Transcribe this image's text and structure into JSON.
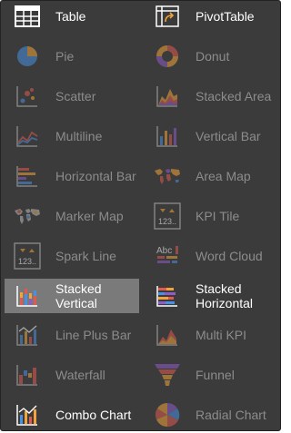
{
  "menu": {
    "items": [
      {
        "key": "table",
        "label": "Table",
        "state": "enabled"
      },
      {
        "key": "pivot",
        "label": "PivotTable",
        "state": "enabled"
      },
      {
        "key": "pie",
        "label": "Pie",
        "state": "disabled"
      },
      {
        "key": "donut",
        "label": "Donut",
        "state": "disabled"
      },
      {
        "key": "scatter",
        "label": "Scatter",
        "state": "disabled"
      },
      {
        "key": "stacked-area",
        "label": "Stacked Area",
        "state": "disabled"
      },
      {
        "key": "multiline",
        "label": "Multiline",
        "state": "disabled"
      },
      {
        "key": "vertical-bar",
        "label": "Vertical Bar",
        "state": "disabled"
      },
      {
        "key": "horizontal-bar",
        "label": "Horizontal Bar",
        "state": "disabled"
      },
      {
        "key": "area-map",
        "label": "Area Map",
        "state": "disabled"
      },
      {
        "key": "marker-map",
        "label": "Marker Map",
        "state": "disabled"
      },
      {
        "key": "kpi-tile",
        "label": "KPI Tile",
        "state": "disabled"
      },
      {
        "key": "spark-line",
        "label": "Spark Line",
        "state": "disabled"
      },
      {
        "key": "word-cloud",
        "label": "Word Cloud",
        "state": "disabled"
      },
      {
        "key": "stacked-vertical",
        "label": "Stacked Vertical",
        "state": "selected"
      },
      {
        "key": "stacked-horizontal",
        "label": "Stacked Horizontal",
        "state": "enabled"
      },
      {
        "key": "line-plus-bar",
        "label": "Line Plus Bar",
        "state": "disabled"
      },
      {
        "key": "multi-kpi",
        "label": "Multi KPI",
        "state": "disabled"
      },
      {
        "key": "waterfall",
        "label": "Waterfall",
        "state": "disabled"
      },
      {
        "key": "funnel",
        "label": "Funnel",
        "state": "disabled"
      },
      {
        "key": "combo-chart",
        "label": "Combo Chart",
        "state": "enabled"
      },
      {
        "key": "radial-chart",
        "label": "Radial Chart",
        "state": "disabled"
      }
    ],
    "kpi_glyph": "123..",
    "word_cloud_glyph": "Abc"
  },
  "colors": {
    "panel_bg": "#3b3b3b",
    "selected_bg": "#7a7a7a",
    "enabled_text": "#ffffff",
    "disabled_text": "#8c8c8c",
    "accent_orange": "#f2a33a",
    "accent_blue": "#4a90e2",
    "accent_red": "#e05a4f",
    "accent_purple": "#8e5cc7"
  }
}
